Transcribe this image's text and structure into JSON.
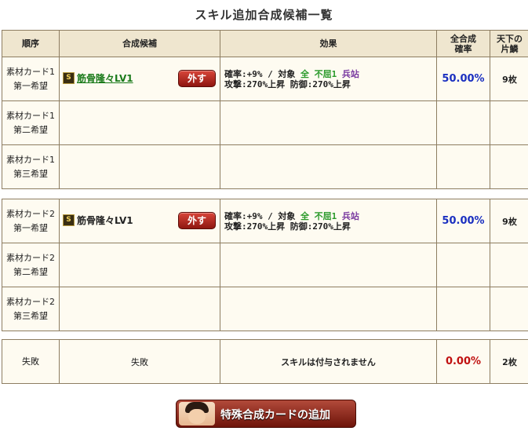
{
  "title": "スキル追加合成候補一覧",
  "headers": {
    "order": "順序",
    "candidate": "合成候補",
    "effect": "効果",
    "rate_line1": "全合成",
    "rate_line2": "確率",
    "count_line1": "天下の",
    "count_line2": "片鱗"
  },
  "group1": {
    "rows": [
      {
        "order1": "素材カード1",
        "order2": "第一希望"
      },
      {
        "order1": "素材カード1",
        "order2": "第二希望"
      },
      {
        "order1": "素材カード1",
        "order2": "第三希望"
      }
    ],
    "badge": "S",
    "skill": "筋骨隆々LV1",
    "remove": "外す",
    "eff_rate": "確率:+9%",
    "eff_sep": "/",
    "eff_target": "対象",
    "eff_all": "全",
    "eff_kind1": "不屈1",
    "eff_kind2": "兵站",
    "eff_line2": "攻撃:270%上昇 防御:270%上昇",
    "rate": "50.00%",
    "count": "9枚"
  },
  "group2": {
    "rows": [
      {
        "order1": "素材カード2",
        "order2": "第一希望"
      },
      {
        "order1": "素材カード2",
        "order2": "第二希望"
      },
      {
        "order1": "素材カード2",
        "order2": "第三希望"
      }
    ],
    "badge": "S",
    "skill": "筋骨隆々LV1",
    "remove": "外す",
    "eff_rate": "確率:+9%",
    "eff_sep": "/",
    "eff_target": "対象",
    "eff_all": "全",
    "eff_kind1": "不屈1",
    "eff_kind2": "兵站",
    "eff_line2": "攻撃:270%上昇 防御:270%上昇",
    "rate": "50.00%",
    "count": "9枚"
  },
  "fail": {
    "order": "失敗",
    "candidate": "失敗",
    "effect": "スキルは付与されません",
    "rate": "0.00%",
    "count": "2枚"
  },
  "special_button": "特殊合成カードの追加",
  "colors": {
    "header_bg": "#efe6cf",
    "cell_bg": "#fefbf1",
    "border": "#8d7d61",
    "rate_blue": "#1a2fc0",
    "rate_red": "#c01010",
    "skill_link": "#1a7a1a"
  }
}
